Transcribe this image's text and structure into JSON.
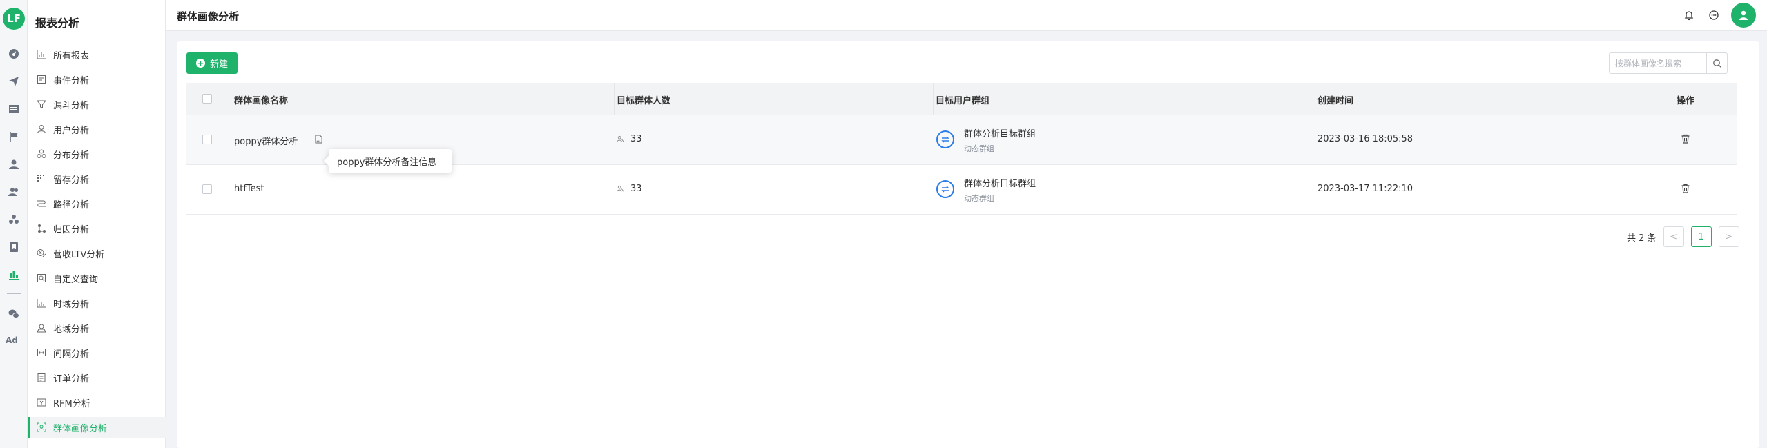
{
  "app": {
    "logo": "LF",
    "section_title": "报表分析",
    "page_title": "群体画像分析"
  },
  "rail": {
    "items": [
      {
        "icon": "dashboard-icon"
      },
      {
        "icon": "send-icon"
      },
      {
        "icon": "table-icon"
      },
      {
        "icon": "flag-icon"
      },
      {
        "icon": "user-icon"
      },
      {
        "icon": "users-icon"
      },
      {
        "icon": "group-icon"
      },
      {
        "icon": "bookmark-icon"
      },
      {
        "icon": "bar-chart-icon"
      },
      {
        "icon": "wechat-icon"
      }
    ],
    "ad_label": "Ad"
  },
  "sidebar": {
    "items": [
      {
        "label": "所有报表",
        "icon": "chart-icon"
      },
      {
        "label": "事件分析",
        "icon": "event-icon"
      },
      {
        "label": "漏斗分析",
        "icon": "funnel-icon"
      },
      {
        "label": "用户分析",
        "icon": "user-icon"
      },
      {
        "label": "分布分析",
        "icon": "distribution-icon"
      },
      {
        "label": "留存分析",
        "icon": "retention-icon"
      },
      {
        "label": "路径分析",
        "icon": "path-icon"
      },
      {
        "label": "归因分析",
        "icon": "attribution-icon"
      },
      {
        "label": "营收LTV分析",
        "icon": "revenue-icon"
      },
      {
        "label": "自定义查询",
        "icon": "query-icon"
      },
      {
        "label": "时域分析",
        "icon": "time-icon"
      },
      {
        "label": "地域分析",
        "icon": "region-icon"
      },
      {
        "label": "间隔分析",
        "icon": "interval-icon"
      },
      {
        "label": "订单分析",
        "icon": "order-icon"
      },
      {
        "label": "RFM分析",
        "icon": "rfm-icon"
      },
      {
        "label": "群体画像分析",
        "icon": "portrait-icon",
        "active": true
      }
    ]
  },
  "toolbar": {
    "new_label": "新建",
    "search_placeholder": "按群体画像名搜索"
  },
  "table": {
    "columns": [
      "群体画像名称",
      "目标群体人数",
      "目标用户群组",
      "创建时间",
      "操作"
    ],
    "rows": [
      {
        "name": "poppy群体分析",
        "count": "33",
        "group_name": "群体分析目标群组",
        "group_type": "动态群组",
        "created": "2023-03-16 18:05:58",
        "note": "poppy群体分析备注信息"
      },
      {
        "name": "htfTest",
        "count": "33",
        "group_name": "群体分析目标群组",
        "group_type": "动态群组",
        "created": "2023-03-17 11:22:10"
      }
    ]
  },
  "pagination": {
    "total": "共 2 条",
    "current": "1",
    "prev": "<",
    "next": ">"
  },
  "colors": {
    "brand": "#1fb26b",
    "link_blue": "#2b7de9"
  }
}
